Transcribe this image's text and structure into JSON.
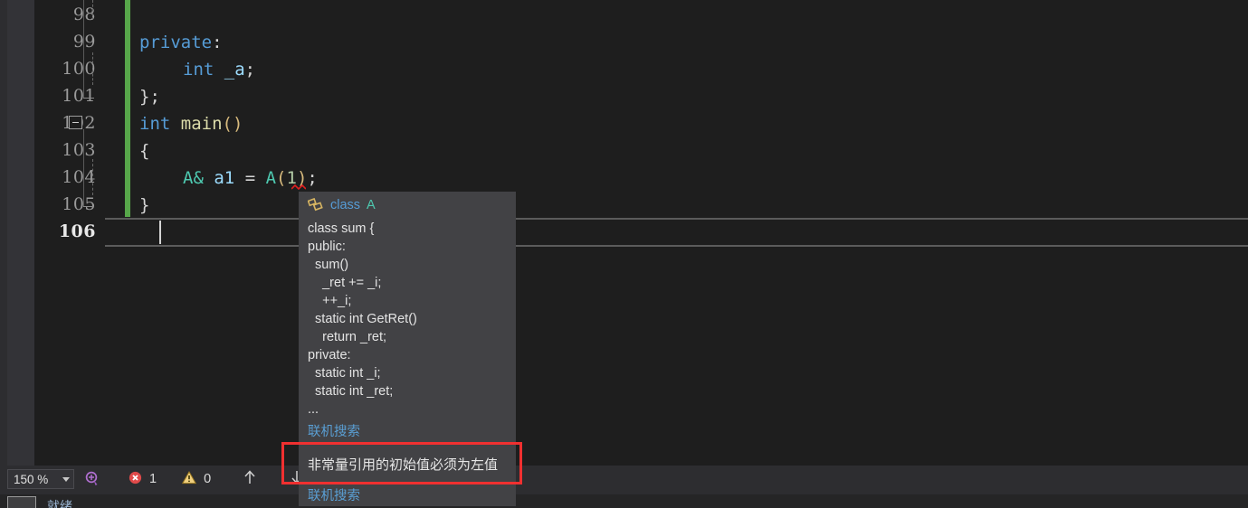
{
  "app": {
    "theme_bg": "#1e1e1e",
    "accent_error": "#f03030"
  },
  "editor": {
    "lines": [
      {
        "number": "98",
        "text": ""
      },
      {
        "number": "99",
        "text": "private:"
      },
      {
        "number": "100",
        "text": "    int _a;"
      },
      {
        "number": "101",
        "text": "};"
      },
      {
        "number": "102",
        "text": "int main()"
      },
      {
        "number": "103",
        "text": "{"
      },
      {
        "number": "104",
        "text": "    A& a1 = A(1);"
      },
      {
        "number": "105",
        "text": "}"
      },
      {
        "number": "106",
        "text": ""
      }
    ],
    "line_numbers": [
      "98",
      "99",
      "100",
      "101",
      "102",
      "103",
      "104",
      "105",
      "106"
    ],
    "current_line": "106",
    "tokens": {
      "private": "private",
      "colon": ":",
      "int": "int",
      "underscore_a": "_a",
      "semi": ";",
      "close_brace_semi": "};",
      "int2": "int",
      "main": "main",
      "parens": "()",
      "open_brace": "{",
      "A_amp": "A&",
      "a1": "a1",
      "equals": "=",
      "A": "A",
      "lparen": "(",
      "one": "1",
      "rparen": ")",
      "semi2": ";",
      "close_brace": "}"
    }
  },
  "tooltip": {
    "icon": "class-icon",
    "header_keyword": "class",
    "header_name": "A",
    "body_lines": [
      "class sum {",
      "public:",
      "  sum()",
      "    _ret += _i;",
      "    ++_i;",
      "  static int GetRet()",
      "    return _ret;",
      "private:",
      "  static int _i;",
      "  static int _ret;",
      "..."
    ],
    "link_top": "联机搜索",
    "error_message": "非常量引用的初始值必须为左值",
    "link_bottom": "联机搜索"
  },
  "statusbar": {
    "zoom_value": "150 %",
    "zoom_dropdown_icon": "chevron-down-icon",
    "intellisense_icon": "code-analysis-icon",
    "error_icon": "error-icon",
    "error_count": "1",
    "warning_icon": "warning-icon",
    "warning_count": "0",
    "prev_icon": "arrow-up-icon",
    "next_icon": "arrow-down-icon"
  },
  "bottom_pane": {
    "status_text": "就绪"
  }
}
